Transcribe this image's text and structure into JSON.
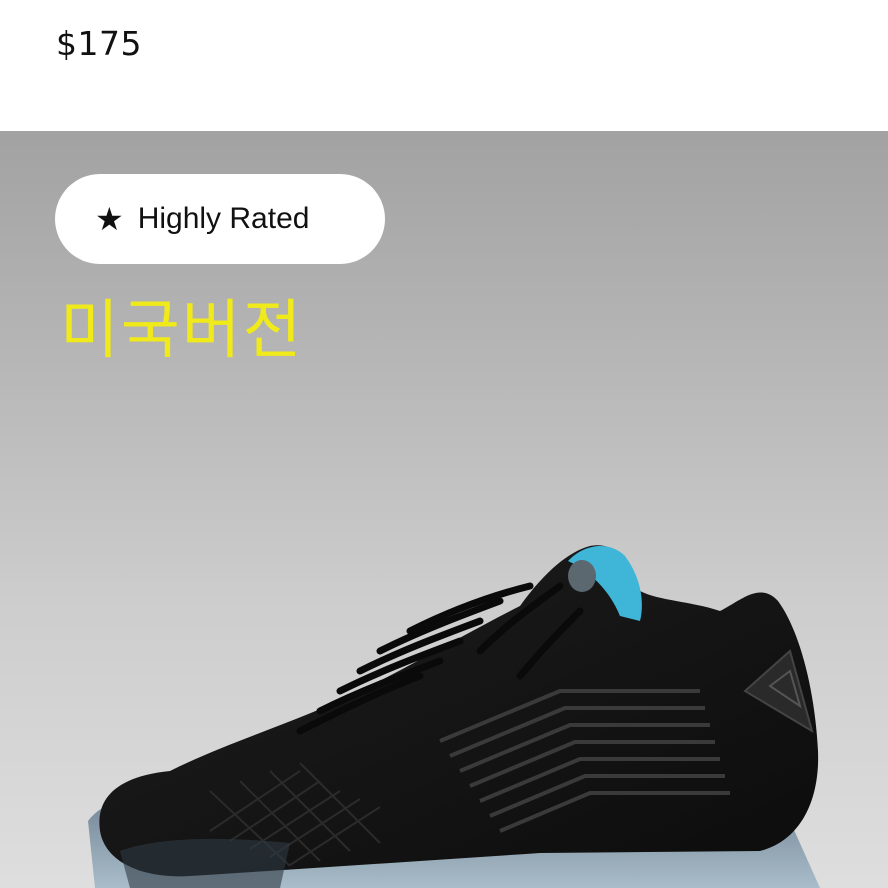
{
  "price": "$175",
  "badge": {
    "icon": "star-icon",
    "label": "Highly Rated"
  },
  "overlay_text": "미국버전",
  "product_image": {
    "subject": "black low-top basketball sneaker with translucent blue sole",
    "colors": {
      "upper": "#151515",
      "sole": "#8ea4b4",
      "accent": "#3fb6d8"
    }
  },
  "colors": {
    "overlay_text": "#f0ea1a",
    "badge_bg": "#ffffff",
    "price_text": "#111111"
  }
}
